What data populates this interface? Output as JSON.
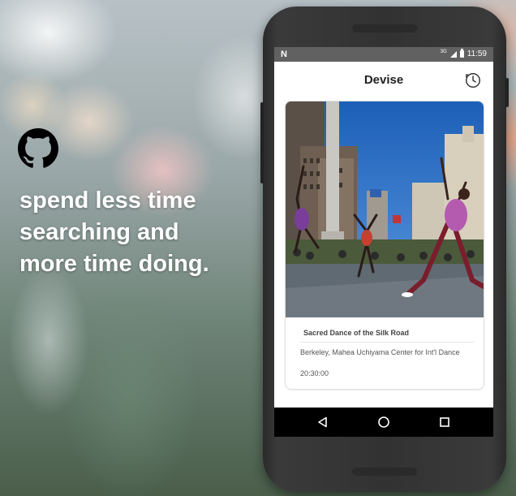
{
  "promo": {
    "tagline_lines": [
      "spend less time",
      "searching and",
      "more time doing."
    ],
    "logo_icon": "github-octocat-icon"
  },
  "statusbar": {
    "left_icon": "n-notification-icon",
    "network": "3G",
    "time": "11:59"
  },
  "appbar": {
    "title": "Devise",
    "action_icon": "history-clock-icon"
  },
  "card": {
    "image_icon": "event-photo",
    "title": "Sacred Dance of the Silk Road",
    "location": "Berkeley, Mahea Uchiyama Center for Int'l Dance",
    "time": "20:30:00"
  },
  "navbar": {
    "back_icon": "back-triangle-icon",
    "home_icon": "home-circle-icon",
    "recents_icon": "recents-square-icon"
  },
  "colors": {
    "statusbar": "#616161",
    "navbar": "#000000",
    "phone_body": "#323232"
  }
}
